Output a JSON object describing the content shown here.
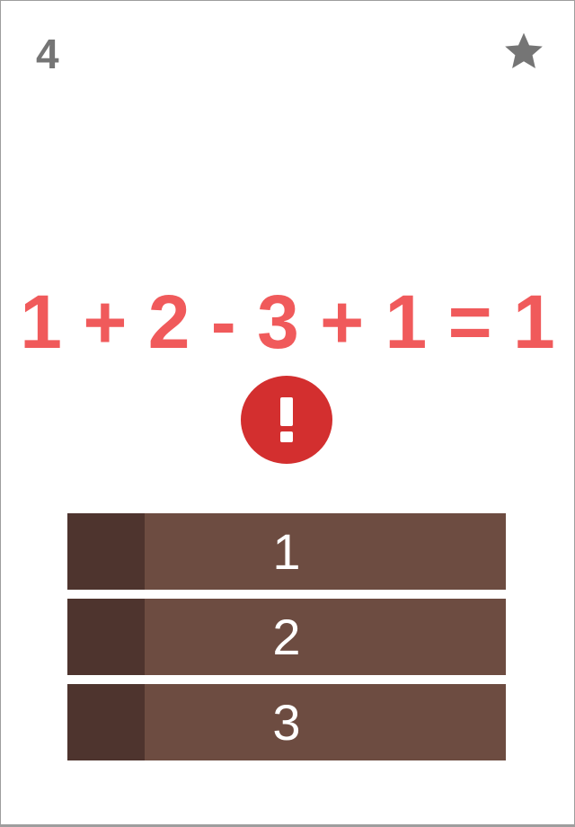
{
  "header": {
    "score": "4",
    "star_icon": "star-icon"
  },
  "equation": {
    "text": "1 + 2 - 3 + 1 = 1",
    "color": "#f05a5b"
  },
  "feedback": {
    "icon": "exclamation-alert-icon",
    "color": "#d32f2f"
  },
  "answers": {
    "items": [
      {
        "label": "1"
      },
      {
        "label": "2"
      },
      {
        "label": "3"
      }
    ],
    "strip_color": "#4e342e",
    "body_color": "#6d4c41"
  },
  "colors": {
    "score": "#757575",
    "star": "#757575"
  }
}
